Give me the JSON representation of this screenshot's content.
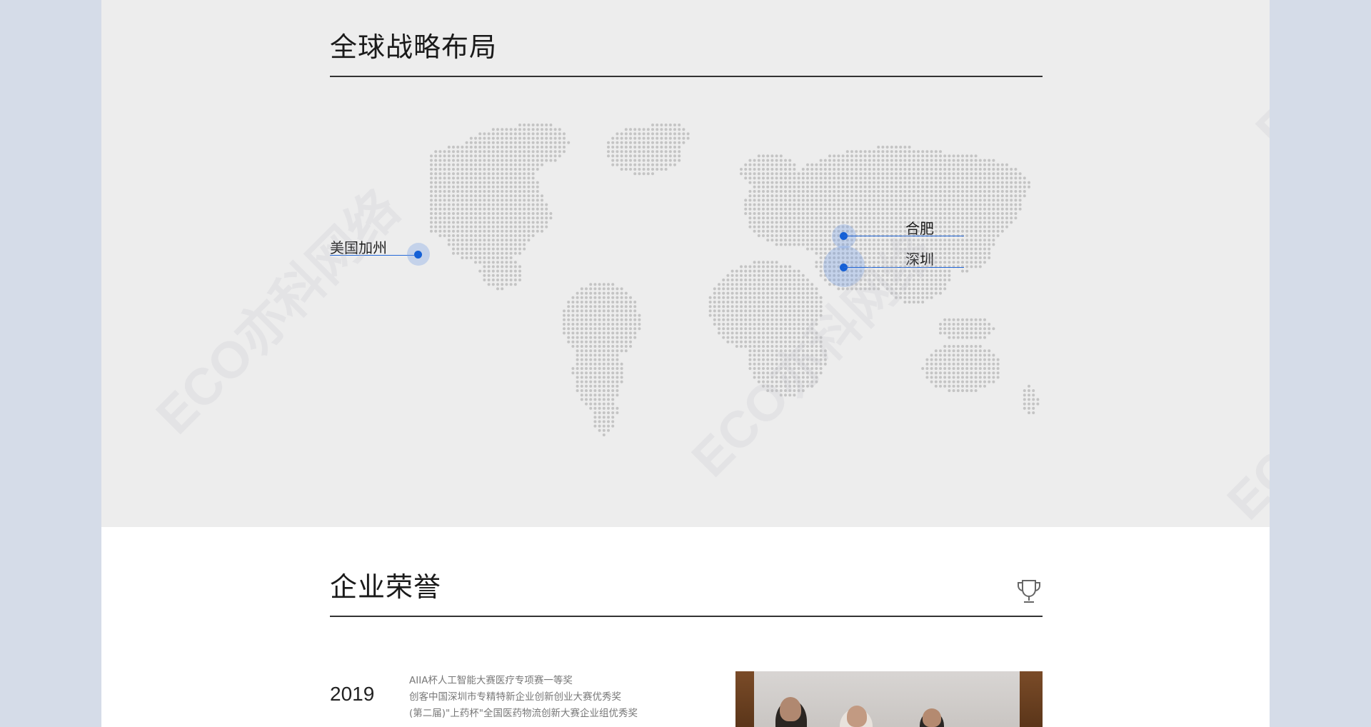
{
  "global_layout": {
    "title": "全球战略布局",
    "locations": [
      {
        "id": "california",
        "label": "美国加州"
      },
      {
        "id": "hefei",
        "label": "合肥"
      },
      {
        "id": "shenzhen",
        "label": "深圳"
      }
    ]
  },
  "honors": {
    "title": "企业荣誉",
    "entries": [
      {
        "year": "2019",
        "awards": [
          "AIIA杯人工智能大赛医疗专项赛一等奖",
          "创客中国深圳市专精特新企业创新创业大赛优秀奖",
          "(第二届)\"上药杯\"全国医药物流创新大赛企业组优秀奖"
        ]
      }
    ]
  },
  "watermark": {
    "text": "ECO亦科网络"
  },
  "colors": {
    "accent": "#1560d6",
    "map_dot": "#c4c4c4",
    "section_bg": "#ededed"
  },
  "icons": {
    "honors": "trophy-icon"
  }
}
